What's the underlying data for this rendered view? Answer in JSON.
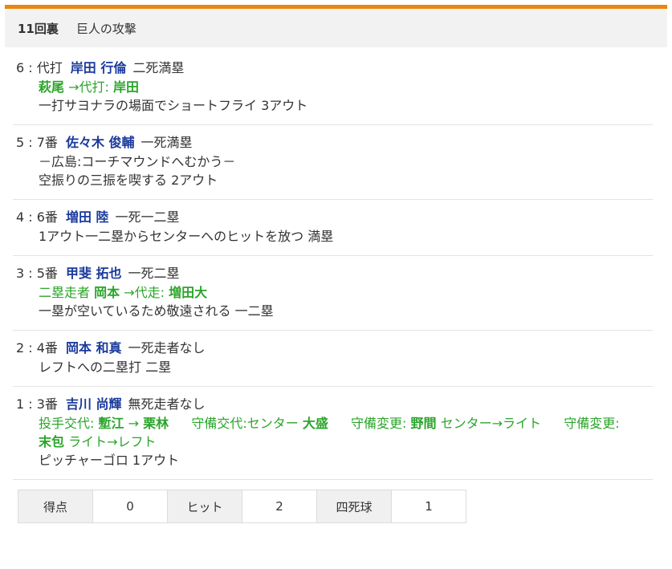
{
  "header": {
    "inning": "11回裏",
    "attack": "巨人の攻撃"
  },
  "plays": [
    {
      "num": "6",
      "order": "代打",
      "batter": "岸田 行倫",
      "situation": "二死満塁",
      "sub_line": {
        "player_from": "萩尾",
        "label": "→代打:",
        "player_to": "岸田"
      },
      "result": "一打サヨナラの場面でショートフライ 3アウト"
    },
    {
      "num": "5",
      "order": "7番",
      "batter": "佐々木 俊輔",
      "situation": "一死満塁",
      "note": "－広島:コーチマウンドへむかう－",
      "result": "空振りの三振を喫する 2アウト"
    },
    {
      "num": "4",
      "order": "6番",
      "batter": "増田 陸",
      "situation": "一死一二塁",
      "result": "1アウト一二塁からセンターへのヒットを放つ 満塁"
    },
    {
      "num": "3",
      "order": "5番",
      "batter": "甲斐 拓也",
      "situation": "一死二塁",
      "sub_line": {
        "prefix": "二塁走者",
        "player_from": "岡本",
        "label": "→代走:",
        "player_to": "増田大"
      },
      "result": "一塁が空いているため敬遠される 一二塁"
    },
    {
      "num": "2",
      "order": "4番",
      "batter": "岡本 和真",
      "situation": "一死走者なし",
      "result": "レフトへの二塁打 二塁"
    },
    {
      "num": "1",
      "order": "3番",
      "batter": "吉川 尚輝",
      "situation": "無死走者なし",
      "changes": {
        "c1_label": "投手交代:",
        "c1_from": "塹江",
        "c1_arrow": "→",
        "c1_to": "栗林",
        "c2_label": "守備交代:センター",
        "c2_player": "大盛",
        "c3_label": "守備変更:",
        "c3_player": "野間",
        "c3_move": "センター→ライト",
        "c4_label": "守備変更:",
        "c4_player": "末包",
        "c4_move": "ライト→レフト"
      },
      "result": "ピッチャーゴロ 1アウト"
    }
  ],
  "summary": {
    "runs_label": "得点",
    "runs": "0",
    "hits_label": "ヒット",
    "hits": "2",
    "walks_label": "四死球",
    "walks": "1"
  },
  "colors": {
    "accent": "#e8870f",
    "player": "#1a3a9c",
    "sub": "#2aa52a"
  }
}
